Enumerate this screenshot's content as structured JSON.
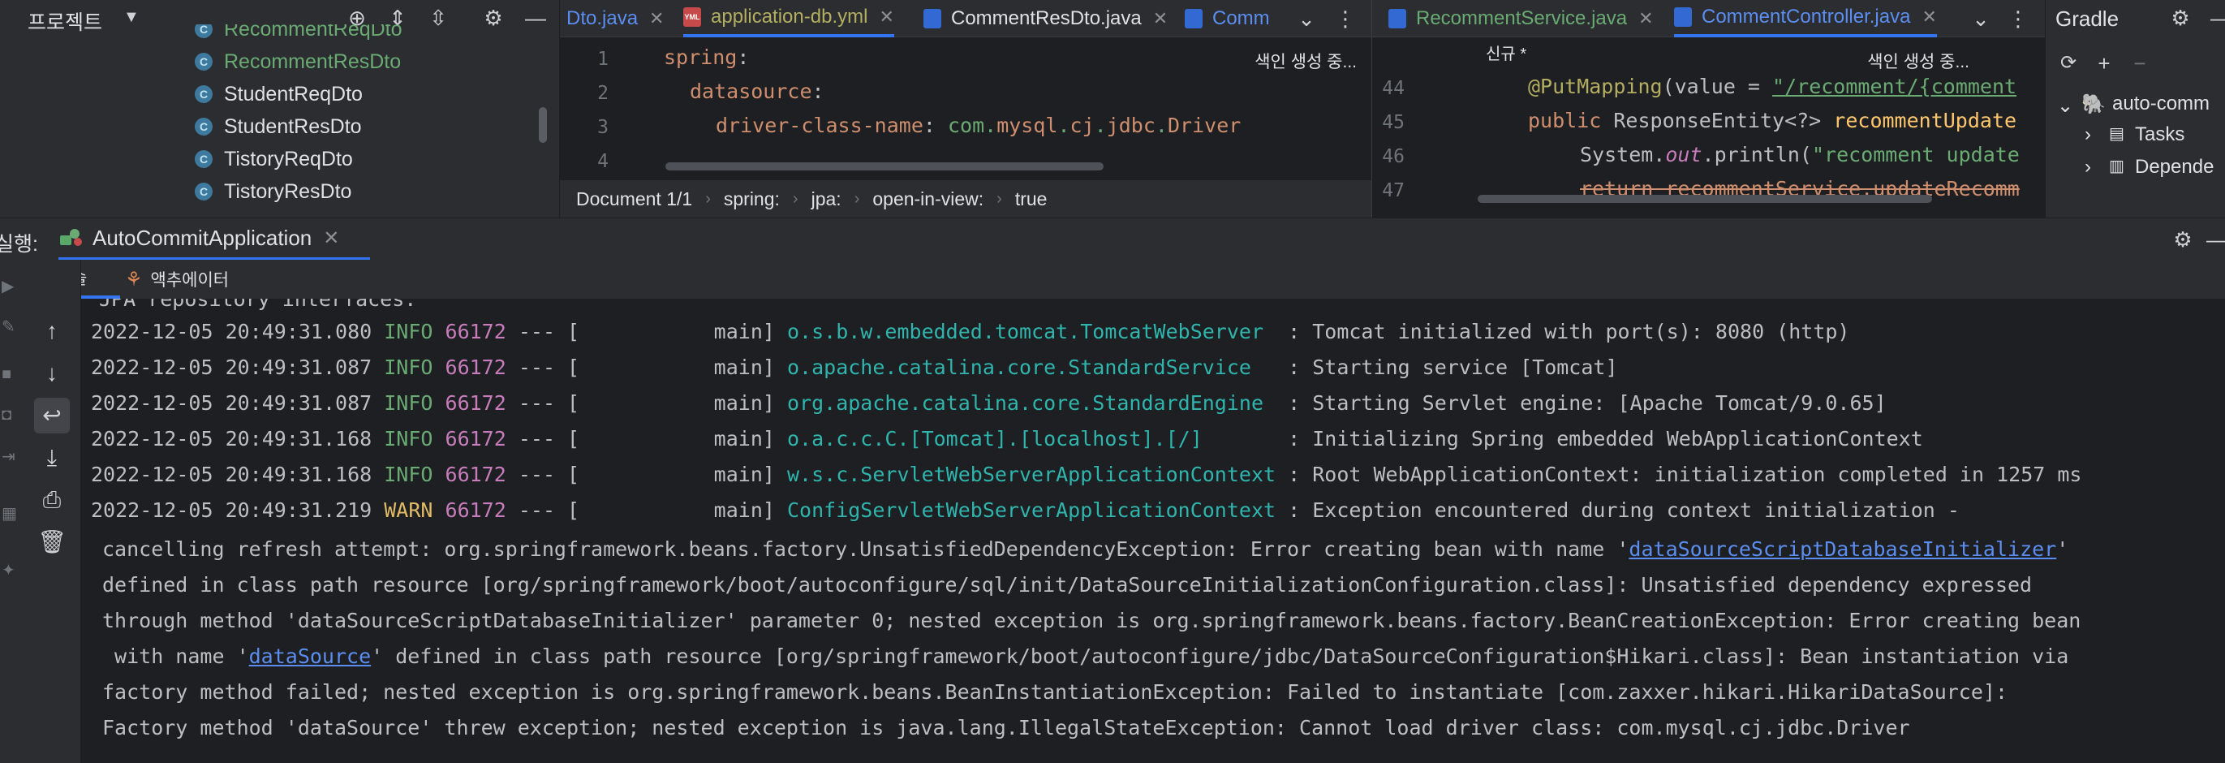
{
  "project": {
    "title": "프로젝트",
    "items": [
      {
        "name": "RecommentReqDto",
        "color": "green"
      },
      {
        "name": "RecommentResDto",
        "color": "green"
      },
      {
        "name": "StudentReqDto",
        "color": "default"
      },
      {
        "name": "StudentResDto",
        "color": "default"
      },
      {
        "name": "TistoryReqDto",
        "color": "default"
      },
      {
        "name": "TistoryResDto",
        "color": "default"
      }
    ]
  },
  "editor1": {
    "tabs": [
      {
        "label": "Dto.java",
        "type": "java",
        "color": "#5b8ef0"
      },
      {
        "label": "application-db.yml",
        "type": "yml",
        "color": "#b3ae60"
      },
      {
        "label": "CommentResDto.java",
        "type": "java",
        "color": "#dfe1e5"
      },
      {
        "label": "Comm",
        "type": "java",
        "color": "#5b8ef0"
      }
    ],
    "status": "색인 생성 중...",
    "lines": [
      {
        "num": "1"
      },
      {
        "num": "2"
      },
      {
        "num": "3"
      },
      {
        "num": "4"
      }
    ],
    "code": {
      "l1_key": "spring",
      "l2_key": "datasource",
      "l3_key": "driver-class-name",
      "l3_val_a": "com.",
      "l3_val_b": "mysql",
      "l3_val_c": ".",
      "l3_val_d": "cj",
      "l3_val_e": ".",
      "l3_val_f": "jdbc",
      "l3_val_g": ".",
      "l3_val_h": "Driver"
    },
    "breadcrumb": [
      "Document 1/1",
      "spring:",
      "jpa:",
      "open-in-view:",
      "true"
    ]
  },
  "editor2": {
    "tabs": [
      {
        "label": "RecommentService.java"
      },
      {
        "label": "CommentController.java"
      }
    ],
    "status": "색인 생성 중...",
    "new_label": "신규 *",
    "lines": [
      {
        "num": "44"
      },
      {
        "num": "45"
      },
      {
        "num": "46"
      },
      {
        "num": "47"
      }
    ],
    "code": {
      "ann": "@PutMapping",
      "ann_open": "(value = ",
      "ann_str": "\"/recomment/{comment",
      "l45_a": "public ",
      "l45_b": "ResponseEntity<?> ",
      "l45_c": "recommentUpdate",
      "l46_a": "System.",
      "l46_b": "out",
      "l46_c": ".println(",
      "l46_d": "\"recomment update",
      "l47": "return recommentService.updateRecomm"
    }
  },
  "gradle": {
    "title": "Gradle",
    "items": [
      "auto-comm",
      "Tasks",
      "Depende"
    ]
  },
  "run": {
    "label": "실행:",
    "tab": "AutoCommitApplication"
  },
  "console_tabs": [
    "콘솔",
    "액추에이터"
  ],
  "console": {
    "header_fragment": "JPA repository interfaces.",
    "logs": [
      {
        "ts": "2022-12-05 20:49:31.080",
        "level": "INFO",
        "pid": "66172",
        "thread": "main",
        "logger": "o.s.b.w.embedded.tomcat.TomcatWebServer ",
        "msg": "Tomcat initialized with port(s): 8080 (http)"
      },
      {
        "ts": "2022-12-05 20:49:31.087",
        "level": "INFO",
        "pid": "66172",
        "thread": "main",
        "logger": "o.apache.catalina.core.StandardService  ",
        "msg": "Starting service [Tomcat]"
      },
      {
        "ts": "2022-12-05 20:49:31.087",
        "level": "INFO",
        "pid": "66172",
        "thread": "main",
        "logger": "org.apache.catalina.core.StandardEngine ",
        "msg": "Starting Servlet engine: [Apache Tomcat/9.0.65]"
      },
      {
        "ts": "2022-12-05 20:49:31.168",
        "level": "INFO",
        "pid": "66172",
        "thread": "main",
        "logger": "o.a.c.c.C.[Tomcat].[localhost].[/]      ",
        "msg": "Initializing Spring embedded WebApplicationContext"
      },
      {
        "ts": "2022-12-05 20:49:31.168",
        "level": "INFO",
        "pid": "66172",
        "thread": "main",
        "logger": "w.s.c.ServletWebServerApplicationContext",
        "msg": "Root WebApplicationContext: initialization completed in 1257 ms"
      },
      {
        "ts": "2022-12-05 20:49:31.219",
        "level": "WARN",
        "pid": "66172",
        "thread": "main",
        "logger": "ConfigServletWebServerApplicationContext",
        "msg": "Exception encountered during context initialization -"
      }
    ],
    "cont1_a": "cancelling refresh attempt: org.springframework.beans.factory.UnsatisfiedDependencyException: Error creating bean with name '",
    "cont1_link": "dataSourceScriptDatabaseInitializer",
    "cont1_b": "'",
    "cont2": "defined in class path resource [org/springframework/boot/autoconfigure/sql/init/DataSourceInitializationConfiguration.class]: Unsatisfied dependency expressed",
    "cont3": "through method 'dataSourceScriptDatabaseInitializer' parameter 0; nested exception is org.springframework.beans.factory.BeanCreationException: Error creating bean",
    "cont4_a": " with name '",
    "cont4_link": "dataSource",
    "cont4_b": "' defined in class path resource [org/springframework/boot/autoconfigure/jdbc/DataSourceConfiguration$Hikari.class]: Bean instantiation via",
    "cont5": "factory method failed; nested exception is org.springframework.beans.BeanInstantiationException: Failed to instantiate [com.zaxxer.hikari.HikariDataSource]:",
    "cont6": "Factory method 'dataSource' threw exception; nested exception is java.lang.IllegalStateException: Cannot load driver class: com.mysql.cj.jdbc.Driver"
  }
}
